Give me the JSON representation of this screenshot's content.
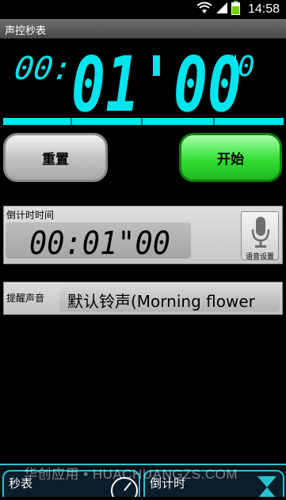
{
  "status_bar": {
    "time": "14:58",
    "icons": [
      "wifi-icon",
      "signal-icon",
      "battery-icon"
    ]
  },
  "app": {
    "title": "声控秒表"
  },
  "display": {
    "prefix": "00:",
    "main": "01'00",
    "suffix": "0",
    "color": "#00e5ee"
  },
  "buttons": {
    "reset_label": "重置",
    "start_label": "开始"
  },
  "countdown": {
    "label": "倒计时时间",
    "value": "00:01\"00",
    "voice_settings_label": "语音设置"
  },
  "alarm": {
    "label": "提醒声音",
    "value": "默认铃声(Morning flower"
  },
  "tabs": [
    {
      "label": "秒表",
      "icon": "stopwatch-icon"
    },
    {
      "label": "倒计时",
      "icon": "hourglass-icon"
    }
  ],
  "watermark": "华创应用 • HUACHUANGZS.COM"
}
